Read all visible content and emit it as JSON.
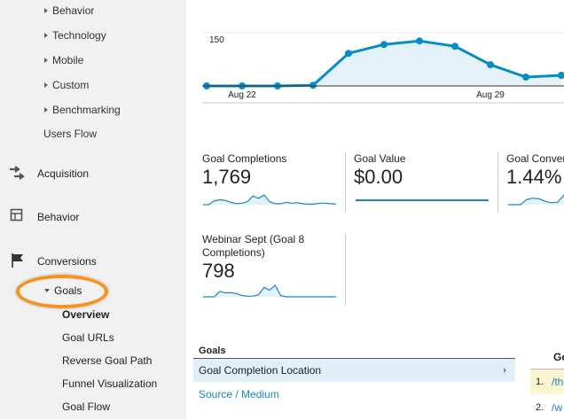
{
  "sidebar": {
    "audience_sub": [
      "Behavior",
      "Technology",
      "Mobile",
      "Custom",
      "Benchmarking"
    ],
    "users_flow": "Users Flow",
    "sections": [
      {
        "label": "Acquisition",
        "icon": "acquisition-arrows-icon"
      },
      {
        "label": "Behavior",
        "icon": "behavior-layout-icon"
      },
      {
        "label": "Conversions",
        "icon": "flag-icon"
      }
    ],
    "goals": "Goals",
    "goal_items": [
      "Overview",
      "Goal URLs",
      "Reverse Goal Path",
      "Funnel Visualization",
      "Goal Flow"
    ],
    "highlight_color": "#f7931e"
  },
  "chart_data": {
    "type": "line",
    "x": [
      "Aug 21",
      "Aug 22",
      "Aug 23",
      "Aug 24",
      "Aug 25",
      "Aug 26",
      "Aug 27",
      "Aug 28",
      "Aug 29",
      "Aug 30",
      "Aug 31"
    ],
    "values": [
      0,
      0,
      0,
      2,
      92,
      117,
      127,
      112,
      60,
      25,
      30
    ],
    "ytick_label": "150",
    "ylim": [
      0,
      150
    ],
    "xtick_labels": [
      "Aug 22",
      "Aug 29"
    ],
    "color": "#058dc7"
  },
  "metrics": [
    {
      "label": "Goal Completions",
      "value": "1,769",
      "spark": [
        0,
        0,
        8,
        10,
        9,
        5,
        2,
        3,
        6,
        18,
        13,
        20,
        6,
        2,
        2,
        5,
        3,
        4,
        2,
        1,
        1,
        3,
        3,
        2,
        1
      ]
    },
    {
      "label": "Goal Value",
      "value": "$0.00",
      "spark": [
        0,
        0,
        0,
        0,
        0,
        0,
        0,
        0,
        0,
        0
      ]
    },
    {
      "label": "Goal Conver",
      "value": "1.44%",
      "spark": [
        0,
        0,
        0,
        8,
        10,
        9,
        5,
        3,
        4,
        15
      ]
    },
    {
      "label": "Webinar Sept (Goal 8 Completions)",
      "value": "798",
      "spark": [
        0,
        0,
        0,
        8,
        6,
        6,
        5,
        2,
        1,
        1,
        3,
        14,
        10,
        17,
        2,
        0,
        0,
        0,
        0,
        0,
        0,
        0,
        0,
        0,
        0
      ]
    }
  ],
  "goals_table": {
    "header": "Goals",
    "rows": [
      "Goal Completion Location",
      "Source / Medium"
    ],
    "right_header": "Go",
    "right_rows": [
      {
        "num": "1.",
        "text": "/th"
      },
      {
        "num": "2.",
        "text": "/w"
      }
    ]
  }
}
